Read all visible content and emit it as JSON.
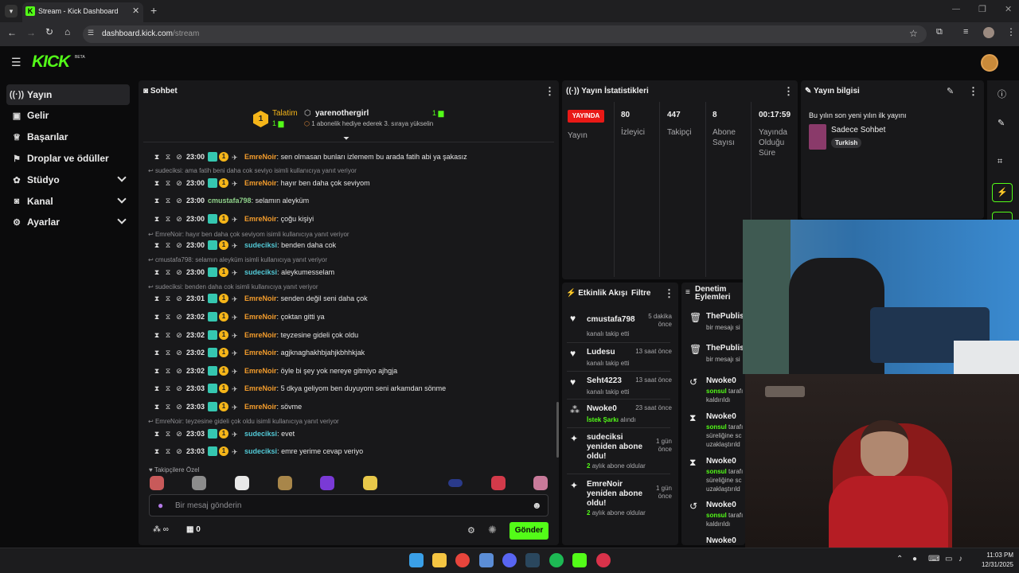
{
  "browser": {
    "tab_title": "Stream - Kick Dashboard",
    "url_host": "dashboard.kick.com",
    "url_path": "/stream",
    "new_tab": "+"
  },
  "app": {
    "logo": "KICK",
    "logo_badge": "BETA",
    "brand_color": "#53fc18"
  },
  "sidebar": {
    "items": [
      {
        "label": "Yayın",
        "icon": "broadcast-icon"
      },
      {
        "label": "Gelir",
        "icon": "money-icon"
      },
      {
        "label": "Başarılar",
        "icon": "trophy-icon"
      },
      {
        "label": "Droplar ve ödüller",
        "icon": "gift-icon"
      },
      {
        "label": "Stüdyo",
        "icon": "palette-icon"
      },
      {
        "label": "Kanal",
        "icon": "chat-icon"
      },
      {
        "label": "Ayarlar",
        "icon": "gear-icon"
      }
    ]
  },
  "chat": {
    "title": "Sohbet",
    "pinned": {
      "label": "Talatim",
      "rank": "1",
      "level": "1",
      "user": "yarenothergirl",
      "count": "1",
      "sub_text": "1 abonelik hediye ederek 3. sıraya yükselin"
    },
    "messages": [
      {
        "time": "23:00",
        "user": "EmreNoir",
        "color": "orange",
        "text": "sen olmasan bunları izlemem bu arada fatih abi ya şakasız"
      },
      {
        "reply": "sudeciksi: ama fatih beni daha cok seviyo isimli kullanıcıya yanıt veriyor"
      },
      {
        "time": "23:00",
        "user": "EmreNoir",
        "color": "orange",
        "text": "hayır ben daha çok seviyom"
      },
      {
        "time": "23:00",
        "user": "cmustafa798",
        "color": "green",
        "text": "selamın aleyküm"
      },
      {
        "time": "23:00",
        "user": "EmreNoir",
        "color": "orange",
        "text": "çoğu kişiyi"
      },
      {
        "reply": "EmreNoir: hayır ben daha çok seviyom isimli kullanıcıya yanıt veriyor"
      },
      {
        "time": "23:00",
        "user": "sudeciksi",
        "color": "blue",
        "text": "benden daha cok"
      },
      {
        "reply": "cmustafa798: selamın aleyküm isimli kullanıcıya yanıt veriyor"
      },
      {
        "time": "23:00",
        "user": "sudeciksi",
        "color": "blue",
        "text": "aleykumesselam"
      },
      {
        "reply": "sudeciksi: benden daha cok isimli kullanıcıya yanıt veriyor"
      },
      {
        "time": "23:01",
        "user": "EmreNoir",
        "color": "orange",
        "text": "senden değil seni daha çok"
      },
      {
        "time": "23:02",
        "user": "EmreNoir",
        "color": "orange",
        "text": "çoktan gitti ya"
      },
      {
        "time": "23:02",
        "user": "EmreNoir",
        "color": "orange",
        "text": "teyzesine gideli çok oldu"
      },
      {
        "time": "23:02",
        "user": "EmreNoir",
        "color": "orange",
        "text": "agjknaghakhbjahjkbhhkjak"
      },
      {
        "time": "23:02",
        "user": "EmreNoir",
        "color": "orange",
        "text": "öyle bi şey yok nereye gitmiyo ajhgja"
      },
      {
        "time": "23:03",
        "user": "EmreNoir",
        "color": "orange",
        "text": "5 dkya geliyom ben duyuyom seni arkamdan sönme"
      },
      {
        "time": "23:03",
        "user": "EmreNoir",
        "color": "orange",
        "text": "sövme"
      },
      {
        "reply": "EmreNoir: teyzesine gideli çok oldu isimli kullanıcıya yanıt veriyor"
      },
      {
        "time": "23:03",
        "user": "sudeciksi",
        "color": "blue",
        "text": "evet"
      },
      {
        "time": "23:03",
        "user": "sudeciksi",
        "color": "blue",
        "text": "emre yerime cevap veriyo"
      }
    ],
    "emote_section": "Takipçilere Özel",
    "input_placeholder": "Bir mesaj gönderin",
    "points_value": "∞",
    "store_value": "0",
    "send_label": "Gönder"
  },
  "stats": {
    "title": "Yayın İstatistikleri",
    "live_badge": "YAYINDA",
    "live_label": "Yayın",
    "viewers": {
      "value": "80",
      "label": "İzleyici"
    },
    "followers": {
      "value": "447",
      "label": "Takipçi"
    },
    "subs": {
      "value": "8",
      "label_1": "Abone",
      "label_2": "Sayısı"
    },
    "duration": {
      "value": "00:17:59",
      "label_1": "Yayında",
      "label_2": "Olduğu",
      "label_3": "Süre"
    }
  },
  "info": {
    "title": "Yayın bilgisi",
    "stream_title": "Bu yılın son yeni yılın ilk yayını",
    "category": "Sadece Sohbet",
    "tag": "Turkish"
  },
  "activity": {
    "title": "Etkinlik Akışı",
    "filter": "Filtre",
    "items": [
      {
        "name": "cmustafa798",
        "time_1": "5 dakika",
        "time_2": "önce",
        "desc": "kanalı takip etti"
      },
      {
        "name": "Ludesu",
        "time_1": "13 saat önce",
        "desc": "kanalı takip etti"
      },
      {
        "name": "Seht4223",
        "time_1": "13 saat önce",
        "desc": "kanalı takip etti"
      },
      {
        "name": "Nwoke0",
        "time_1": "23 saat önce",
        "desc_hl": "İstek Şarkı",
        "desc": "alındı"
      },
      {
        "name_1": "sudeciksi",
        "name_2": "yeniden abone",
        "name_3": "oldu!",
        "time_1": "1 gün",
        "time_2": "önce",
        "desc_hl": "2",
        "desc": "aylık abone oldular"
      },
      {
        "name_1": "EmreNoir",
        "name_2": "yeniden abone",
        "name_3": "oldu!",
        "time_1": "1 gün",
        "time_2": "önce",
        "desc_hl": "2",
        "desc": "aylık abone oldular"
      }
    ]
  },
  "moderation": {
    "title_1": "Denetim",
    "title_2": "Eylemleri",
    "items": [
      {
        "name": "ThePublis",
        "d1": "bir mesajı si"
      },
      {
        "name": "ThePublis",
        "d1": "bir mesajı si"
      },
      {
        "name": "Nwoke0",
        "hl": "sonsul",
        "d1": " tarafı",
        "d2": "kaldırıldı"
      },
      {
        "name": "Nwoke0",
        "hl": "sonsul",
        "d1": " tarafı",
        "d2": "süreliğine sc",
        "d3": "uzaklaştırıld"
      },
      {
        "name": "Nwoke0",
        "hl": "sonsul",
        "d1": " tarafı",
        "d2": "süreliğine sc",
        "d3": "uzaklaştırıld"
      },
      {
        "name": "Nwoke0",
        "hl": "sonsul",
        "d1": " tarafı",
        "d2": "kaldırıldı"
      },
      {
        "name": "Nwoke0"
      }
    ]
  },
  "system": {
    "time": "11:03 PM",
    "date": "12/31/2025"
  }
}
